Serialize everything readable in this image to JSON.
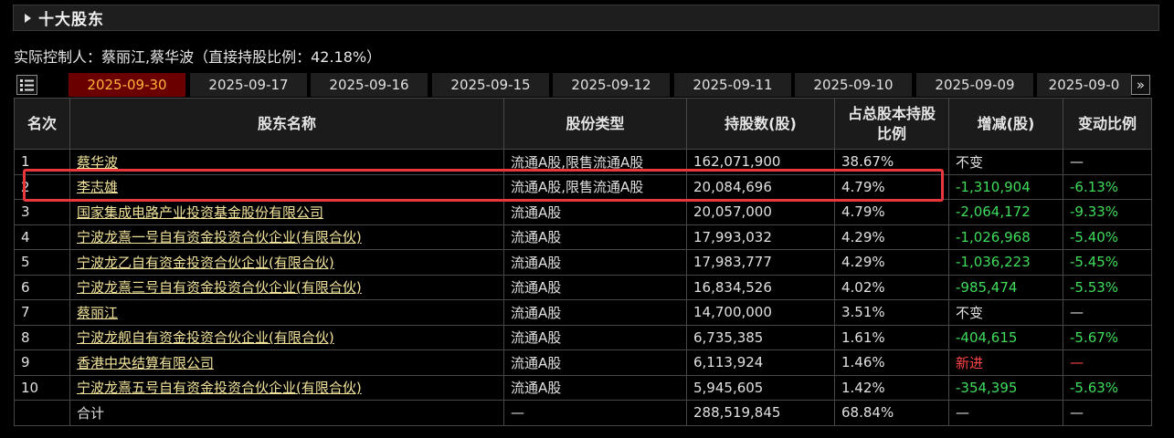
{
  "section": {
    "title": "十大股东"
  },
  "controller_text": "实际控制人：蔡丽江,蔡华波（直接持股比例：42.18%）",
  "tabs": [
    {
      "label": "2025-09-30",
      "active": true
    },
    {
      "label": "2025-09-17",
      "active": false
    },
    {
      "label": "2025-09-16",
      "active": false
    },
    {
      "label": "2025-09-15",
      "active": false
    },
    {
      "label": "2025-09-12",
      "active": false
    },
    {
      "label": "2025-09-11",
      "active": false
    },
    {
      "label": "2025-09-10",
      "active": false
    },
    {
      "label": "2025-09-09",
      "active": false
    },
    {
      "label": "2025-09-0",
      "active": false
    }
  ],
  "table": {
    "headers": [
      "名次",
      "股东名称",
      "股份类型",
      "持股数(股)",
      "占总股本持股比例",
      "增减(股)",
      "变动比例"
    ],
    "rows": [
      {
        "rank": "1",
        "name": "蔡华波",
        "type": "流通A股,限售流通A股",
        "shares": "162,071,900",
        "ratio": "38.67%",
        "change": "不变",
        "change_ratio": "—"
      },
      {
        "rank": "2",
        "name": "李志雄",
        "type": "流通A股,限售流通A股",
        "shares": "20,084,696",
        "ratio": "4.79%",
        "change": "-1,310,904",
        "change_ratio": "-6.13%"
      },
      {
        "rank": "3",
        "name": "国家集成电路产业投资基金股份有限公司",
        "type": "流通A股",
        "shares": "20,057,000",
        "ratio": "4.79%",
        "change": "-2,064,172",
        "change_ratio": "-9.33%"
      },
      {
        "rank": "4",
        "name": "宁波龙熹一号自有资金投资合伙企业(有限合伙)",
        "type": "流通A股",
        "shares": "17,993,032",
        "ratio": "4.29%",
        "change": "-1,026,968",
        "change_ratio": "-5.40%"
      },
      {
        "rank": "5",
        "name": "宁波龙乙自有资金投资合伙企业(有限合伙)",
        "type": "流通A股",
        "shares": "17,983,777",
        "ratio": "4.29%",
        "change": "-1,036,223",
        "change_ratio": "-5.45%"
      },
      {
        "rank": "6",
        "name": "宁波龙熹三号自有资金投资合伙企业(有限合伙)",
        "type": "流通A股",
        "shares": "16,834,526",
        "ratio": "4.02%",
        "change": "-985,474",
        "change_ratio": "-5.53%"
      },
      {
        "rank": "7",
        "name": "蔡丽江",
        "type": "流通A股",
        "shares": "14,700,000",
        "ratio": "3.51%",
        "change": "不变",
        "change_ratio": "—"
      },
      {
        "rank": "8",
        "name": "宁波龙舰自有资金投资合伙企业(有限合伙)",
        "type": "流通A股",
        "shares": "6,735,385",
        "ratio": "1.61%",
        "change": "-404,615",
        "change_ratio": "-5.67%"
      },
      {
        "rank": "9",
        "name": "香港中央结算有限公司",
        "type": "流通A股",
        "shares": "6,113,924",
        "ratio": "1.46%",
        "change": "新进",
        "change_ratio": "—"
      },
      {
        "rank": "10",
        "name": "宁波龙熹五号自有资金投资合伙企业(有限合伙)",
        "type": "流通A股",
        "shares": "5,945,605",
        "ratio": "1.42%",
        "change": "-354,395",
        "change_ratio": "-5.63%"
      }
    ],
    "total": {
      "label": "合计",
      "type": "—",
      "shares": "288,519,845",
      "ratio": "68.84%",
      "change": "—",
      "change_ratio": "—"
    }
  },
  "colors": {
    "accent_tab_bg": "#6b0000",
    "accent_tab_text": "#ffb23a",
    "link": "#f0e29a",
    "decrease": "#3fdc5c",
    "new_entry": "#ff4545",
    "highlight_border": "#e8383d"
  },
  "icons": {
    "menu": "list-menu-icon",
    "next": "double-chevron-right-icon"
  }
}
